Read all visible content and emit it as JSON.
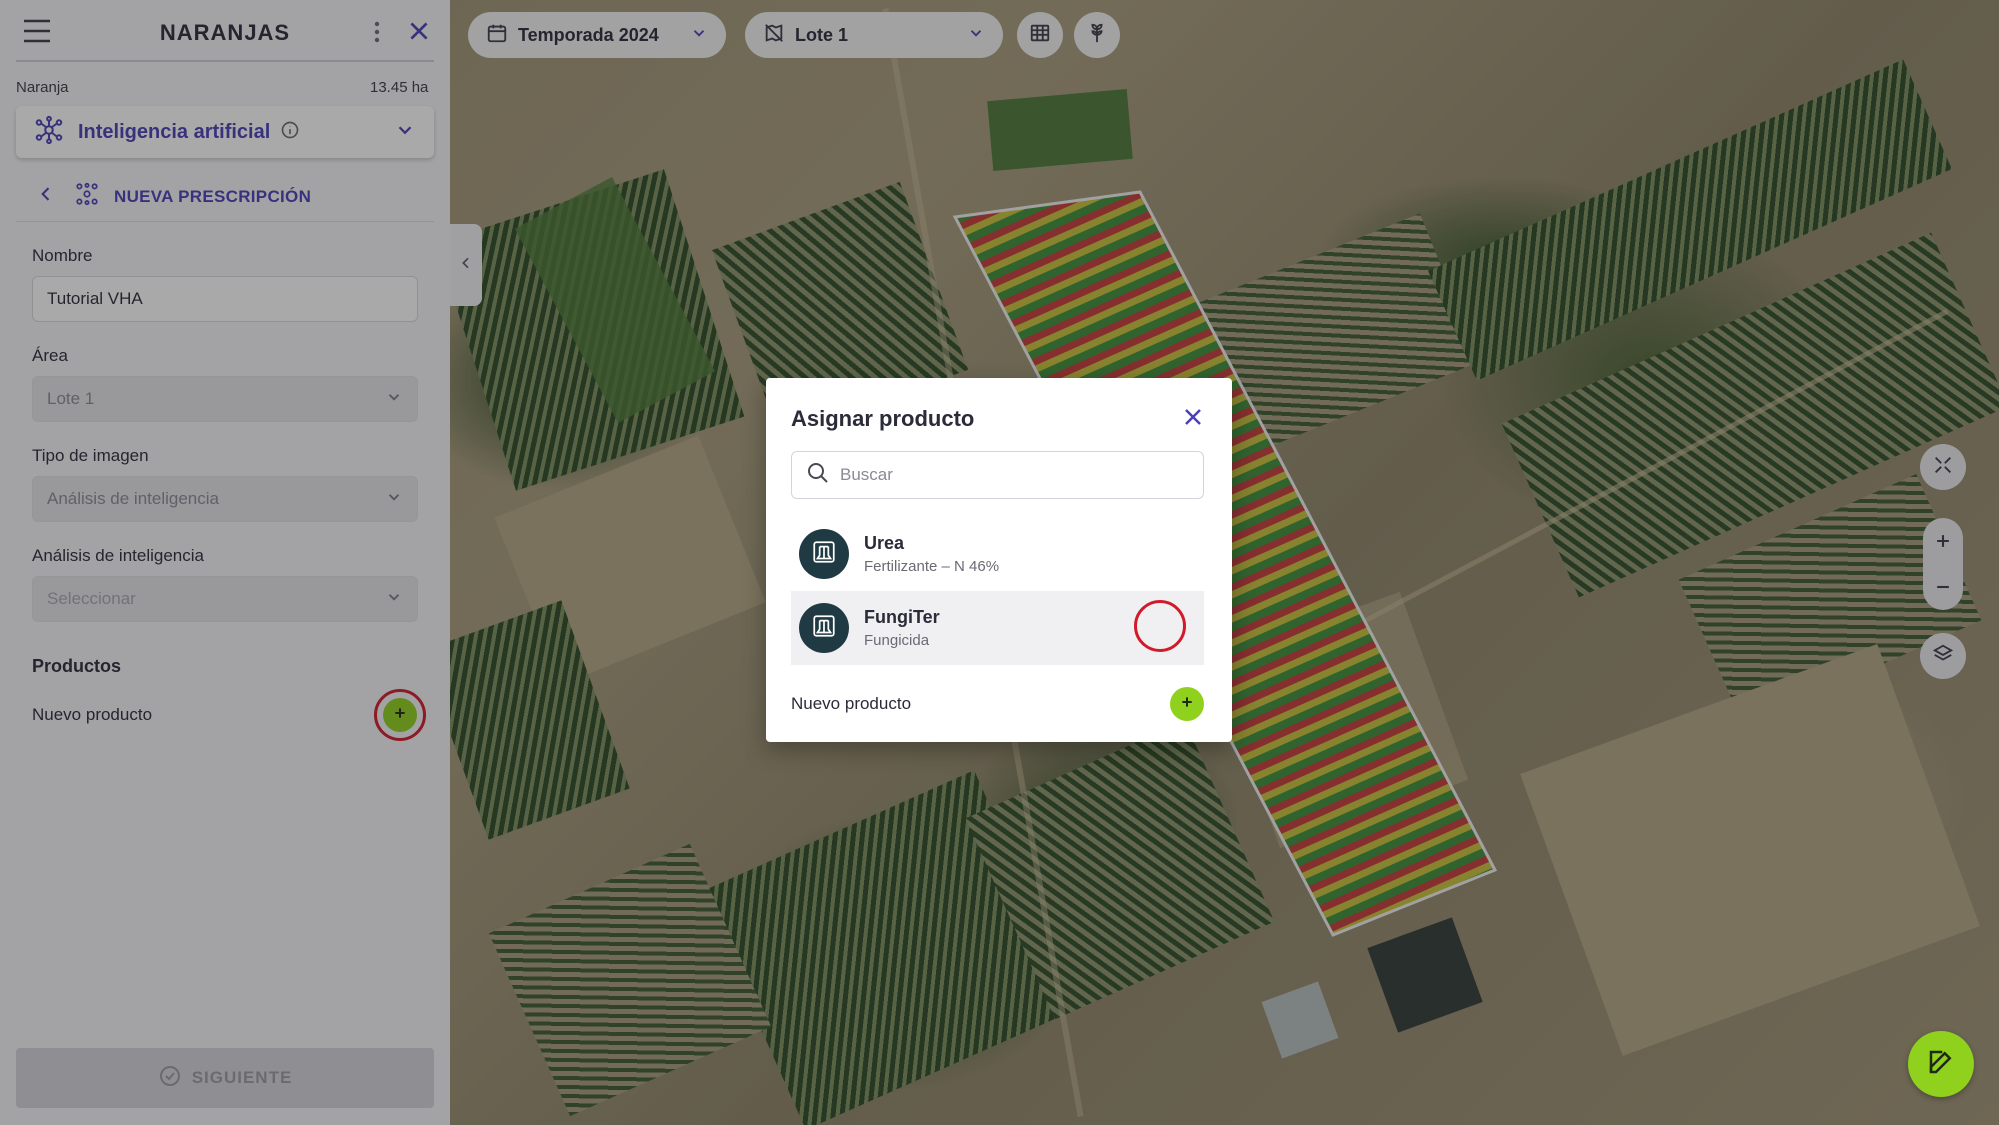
{
  "topbar": {
    "season_label": "Temporada 2024",
    "lot_label": "Lote 1"
  },
  "sidebar": {
    "title": "NARANJAS",
    "crop_name": "Naranja",
    "area": "13.45 ha",
    "ai_section_label": "Inteligencia artificial",
    "back_label": "NUEVA PRESCRIPCIÓN",
    "form": {
      "name_label": "Nombre",
      "name_value": "Tutorial VHA",
      "area_label": "Área",
      "area_value": "Lote 1",
      "image_type_label": "Tipo de imagen",
      "image_type_value": "Análisis de inteligencia",
      "ai_analysis_label": "Análisis de inteligencia",
      "ai_analysis_placeholder": "Seleccionar",
      "products_label": "Productos",
      "new_product_label": "Nuevo producto"
    },
    "next_label": "SIGUIENTE"
  },
  "modal": {
    "title": "Asignar producto",
    "search_placeholder": "Buscar",
    "products": [
      {
        "name": "Urea",
        "subtitle": "Fertilizante – N 46%"
      },
      {
        "name": "FungiTer",
        "subtitle": "Fungicida"
      }
    ],
    "new_product_label": "Nuevo producto"
  },
  "icons": {
    "menu": "hamburger-icon",
    "more": "kebab-icon",
    "close": "close-icon",
    "calendar": "calendar-icon",
    "lot": "lot-map-icon",
    "table": "table-icon",
    "plant": "plant-icon",
    "ai": "ai-network-icon",
    "info": "info-icon",
    "search": "search-icon",
    "product": "product-flask-icon",
    "plus": "plus-icon",
    "edit": "edit-icon",
    "layers": "layers-icon",
    "fullscreen": "fit-extent-icon"
  },
  "colors": {
    "accent": "#4a3fb8",
    "action_green": "#8fd11c",
    "highlight_red": "#d11a2a",
    "product_avatar": "#1f3a42"
  }
}
